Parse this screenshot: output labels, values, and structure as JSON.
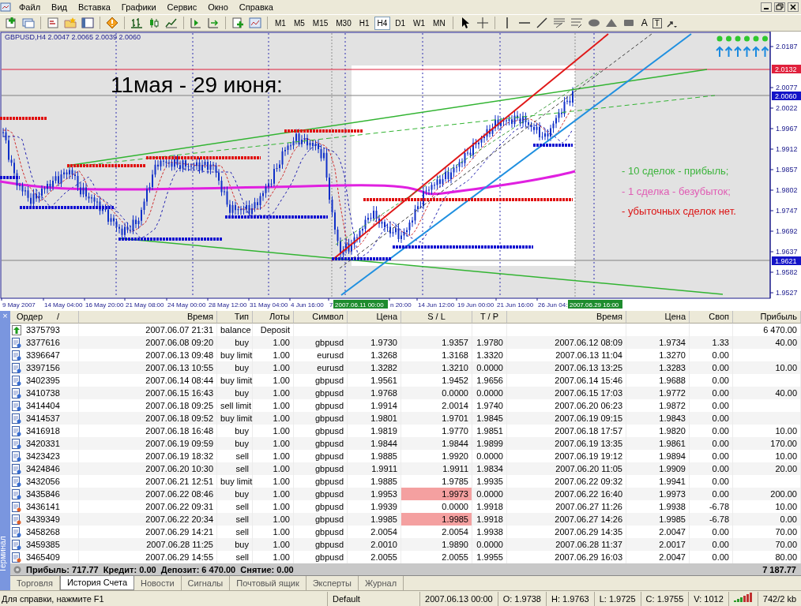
{
  "menu": [
    "Файл",
    "Вид",
    "Вставка",
    "Графики",
    "Сервис",
    "Окно",
    "Справка"
  ],
  "toolbar": {
    "timeframes": [
      {
        "label": "M1",
        "selected": false
      },
      {
        "label": "M5",
        "selected": false
      },
      {
        "label": "M15",
        "selected": false
      },
      {
        "label": "M30",
        "selected": false
      },
      {
        "label": "H1",
        "selected": false
      },
      {
        "label": "H4",
        "selected": true
      },
      {
        "label": "D1",
        "selected": false
      },
      {
        "label": "W1",
        "selected": false
      },
      {
        "label": "MN",
        "selected": false
      }
    ],
    "tool_letters": [
      "A",
      "T"
    ]
  },
  "chart": {
    "header": "GBPUSD,H4  2.0047 2.0065 2.0039 2.0060",
    "headline": "11мая - 29 июня:",
    "notes": [
      {
        "text": "- 10 сделок - прибыль;",
        "color": "#3cb43c"
      },
      {
        "text": "- 1 сделка - безубыток;",
        "color": "#e05cb4"
      },
      {
        "text": "- убыточных сделок нет.",
        "color": "#dc1414"
      }
    ],
    "price_axis": [
      {
        "label": "2.0187",
        "kind": "tick"
      },
      {
        "label": "2.0132",
        "kind": "marker",
        "color": "#e0203c"
      },
      {
        "label": "2.0077",
        "kind": "tick"
      },
      {
        "label": "2.0060",
        "kind": "marker",
        "color": "#1414c8"
      },
      {
        "label": "2.0022",
        "kind": "tick"
      },
      {
        "label": "1.9967",
        "kind": "tick"
      },
      {
        "label": "1.9912",
        "kind": "tick"
      },
      {
        "label": "1.9857",
        "kind": "tick"
      },
      {
        "label": "1.9802",
        "kind": "tick"
      },
      {
        "label": "1.9747",
        "kind": "tick"
      },
      {
        "label": "1.9692",
        "kind": "tick"
      },
      {
        "label": "1.9637",
        "kind": "tick"
      },
      {
        "label": "1.9621",
        "kind": "marker",
        "color": "#1414c8"
      },
      {
        "label": "1.9582",
        "kind": "tick"
      },
      {
        "label": "1.9527",
        "kind": "tick"
      }
    ],
    "time_axis": [
      {
        "label": "9 May 2007",
        "kind": "tick"
      },
      {
        "label": "14 May 04:00",
        "kind": "tick"
      },
      {
        "label": "16 May 20:00",
        "kind": "tick"
      },
      {
        "label": "21 May 08:00",
        "kind": "tick"
      },
      {
        "label": "24 May 00:00",
        "kind": "tick"
      },
      {
        "label": "28 May 12:00",
        "kind": "tick"
      },
      {
        "label": "31 May 04:00",
        "kind": "tick"
      },
      {
        "label": "4 Jun 16:00",
        "kind": "tick"
      },
      {
        "label": "7",
        "kind": "tick"
      },
      {
        "label": "2007.06.11 00:00",
        "kind": "marker"
      },
      {
        "label": "n 20:00",
        "kind": "tick"
      },
      {
        "label": "14 Jun 12:00",
        "kind": "tick"
      },
      {
        "label": "19 Jun 00:00",
        "kind": "tick"
      },
      {
        "label": "21 Jun 16:00",
        "kind": "tick"
      },
      {
        "label": "26 Jun 04:",
        "kind": "tick"
      },
      {
        "label": "2007.06.29 16:00",
        "kind": "marker"
      }
    ]
  },
  "terminal": {
    "title": "Терминал",
    "close": "×",
    "sort_mark": "/",
    "columns": [
      "Ордер",
      "Время",
      "Тип",
      "Лоты",
      "Символ",
      "Цена",
      "S / L",
      "T / P",
      "Время",
      "Цена",
      "Своп",
      "Прибыль"
    ],
    "rows": [
      {
        "kind": "balance",
        "sl_highlight": false,
        "order": "3375793",
        "open_time": "2007.06.07 21:31",
        "type": "balance",
        "size": "Deposit",
        "profit": "6 470.00"
      },
      {
        "kind": "buy",
        "sl_highlight": false,
        "order": "3377616",
        "open_time": "2007.06.08 09:20",
        "type": "buy",
        "size": "1.00",
        "symbol": "gbpusd",
        "open_price": "1.9730",
        "sl": "1.9357",
        "tp": "1.9780",
        "close_time": "2007.06.12 08:09",
        "close_price": "1.9734",
        "swap": "1.33",
        "profit": "40.00"
      },
      {
        "kind": "buy",
        "sl_highlight": false,
        "order": "3396647",
        "open_time": "2007.06.13 09:48",
        "type": "buy limit",
        "size": "1.00",
        "symbol": "eurusd",
        "open_price": "1.3268",
        "sl": "1.3168",
        "tp": "1.3320",
        "close_time": "2007.06.13 11:04",
        "close_price": "1.3270",
        "swap": "0.00"
      },
      {
        "kind": "buy",
        "sl_highlight": false,
        "order": "3397156",
        "open_time": "2007.06.13 10:55",
        "type": "buy",
        "size": "1.00",
        "symbol": "eurusd",
        "open_price": "1.3282",
        "sl": "1.3210",
        "tp": "0.0000",
        "close_time": "2007.06.13 13:25",
        "close_price": "1.3283",
        "swap": "0.00",
        "profit": "10.00"
      },
      {
        "kind": "buy",
        "sl_highlight": false,
        "order": "3402395",
        "open_time": "2007.06.14 08:44",
        "type": "buy limit",
        "size": "1.00",
        "symbol": "gbpusd",
        "open_price": "1.9561",
        "sl": "1.9452",
        "tp": "1.9656",
        "close_time": "2007.06.14 15:46",
        "close_price": "1.9688",
        "swap": "0.00"
      },
      {
        "kind": "buy",
        "sl_highlight": false,
        "order": "3410738",
        "open_time": "2007.06.15 16:43",
        "type": "buy",
        "size": "1.00",
        "symbol": "gbpusd",
        "open_price": "1.9768",
        "sl": "0.0000",
        "tp": "0.0000",
        "close_time": "2007.06.15 17:03",
        "close_price": "1.9772",
        "swap": "0.00",
        "profit": "40.00"
      },
      {
        "kind": "buy",
        "sl_highlight": false,
        "order": "3414404",
        "open_time": "2007.06.18 09:25",
        "type": "sell limit",
        "size": "1.00",
        "symbol": "gbpusd",
        "open_price": "1.9914",
        "sl": "2.0014",
        "tp": "1.9740",
        "close_time": "2007.06.20 06:23",
        "close_price": "1.9872",
        "swap": "0.00"
      },
      {
        "kind": "buy",
        "sl_highlight": false,
        "order": "3414537",
        "open_time": "2007.06.18 09:52",
        "type": "buy limit",
        "size": "1.00",
        "symbol": "gbpusd",
        "open_price": "1.9801",
        "sl": "1.9701",
        "tp": "1.9845",
        "close_time": "2007.06.19 09:15",
        "close_price": "1.9843",
        "swap": "0.00"
      },
      {
        "kind": "buy",
        "sl_highlight": false,
        "order": "3416918",
        "open_time": "2007.06.18 16:48",
        "type": "buy",
        "size": "1.00",
        "symbol": "gbpusd",
        "open_price": "1.9819",
        "sl": "1.9770",
        "tp": "1.9851",
        "close_time": "2007.06.18 17:57",
        "close_price": "1.9820",
        "swap": "0.00",
        "profit": "10.00"
      },
      {
        "kind": "buy",
        "sl_highlight": false,
        "order": "3420331",
        "open_time": "2007.06.19 09:59",
        "type": "buy",
        "size": "1.00",
        "symbol": "gbpusd",
        "open_price": "1.9844",
        "sl": "1.9844",
        "tp": "1.9899",
        "close_time": "2007.06.19 13:35",
        "close_price": "1.9861",
        "swap": "0.00",
        "profit": "170.00"
      },
      {
        "kind": "buy",
        "sl_highlight": false,
        "order": "3423423",
        "open_time": "2007.06.19 18:32",
        "type": "sell",
        "size": "1.00",
        "symbol": "gbpusd",
        "open_price": "1.9885",
        "sl": "1.9920",
        "tp": "0.0000",
        "close_time": "2007.06.19 19:12",
        "close_price": "1.9894",
        "swap": "0.00",
        "profit": "10.00"
      },
      {
        "kind": "buy",
        "sl_highlight": false,
        "order": "3424846",
        "open_time": "2007.06.20 10:30",
        "type": "sell",
        "size": "1.00",
        "symbol": "gbpusd",
        "open_price": "1.9911",
        "sl": "1.9911",
        "tp": "1.9834",
        "close_time": "2007.06.20 11:05",
        "close_price": "1.9909",
        "swap": "0.00",
        "profit": "20.00"
      },
      {
        "kind": "buy",
        "sl_highlight": false,
        "order": "3432056",
        "open_time": "2007.06.21 12:51",
        "type": "buy limit",
        "size": "1.00",
        "symbol": "gbpusd",
        "open_price": "1.9885",
        "sl": "1.9785",
        "tp": "1.9935",
        "close_time": "2007.06.22 09:32",
        "close_price": "1.9941",
        "swap": "0.00"
      },
      {
        "kind": "buy",
        "sl_highlight": true,
        "order": "3435846",
        "open_time": "2007.06.22 08:46",
        "type": "buy",
        "size": "1.00",
        "symbol": "gbpusd",
        "open_price": "1.9953",
        "sl": "1.9973",
        "tp": "0.0000",
        "close_time": "2007.06.22 16:40",
        "close_price": "1.9973",
        "swap": "0.00",
        "profit": "200.00"
      },
      {
        "kind": "sell",
        "sl_highlight": false,
        "order": "3436141",
        "open_time": "2007.06.22 09:31",
        "type": "sell",
        "size": "1.00",
        "symbol": "gbpusd",
        "open_price": "1.9939",
        "sl": "0.0000",
        "tp": "1.9918",
        "close_time": "2007.06.27 11:26",
        "close_price": "1.9938",
        "swap": "-6.78",
        "profit": "10.00"
      },
      {
        "kind": "sell",
        "sl_highlight": true,
        "order": "3439349",
        "open_time": "2007.06.22 20:34",
        "type": "sell",
        "size": "1.00",
        "symbol": "gbpusd",
        "open_price": "1.9985",
        "sl": "1.9985",
        "tp": "1.9918",
        "close_time": "2007.06.27 14:26",
        "close_price": "1.9985",
        "swap": "-6.78",
        "profit": "0.00"
      },
      {
        "kind": "buy",
        "sl_highlight": false,
        "order": "3458268",
        "open_time": "2007.06.29 14:21",
        "type": "sell",
        "size": "1.00",
        "symbol": "gbpusd",
        "open_price": "2.0054",
        "sl": "2.0054",
        "tp": "1.9938",
        "close_time": "2007.06.29 14:35",
        "close_price": "2.0047",
        "swap": "0.00",
        "profit": "70.00"
      },
      {
        "kind": "buy",
        "sl_highlight": false,
        "order": "3459385",
        "open_time": "2007.06.28 11:25",
        "type": "buy",
        "size": "1.00",
        "symbol": "gbpusd",
        "open_price": "2.0010",
        "sl": "1.9890",
        "tp": "0.0000",
        "close_time": "2007.06.28 11:37",
        "close_price": "2.0017",
        "swap": "0.00",
        "profit": "70.00"
      },
      {
        "kind": "sell",
        "sl_highlight": false,
        "order": "3465409",
        "open_time": "2007.06.29 14:55",
        "type": "sell",
        "size": "1.00",
        "symbol": "gbpusd",
        "open_price": "2.0055",
        "sl": "2.0055",
        "tp": "1.9955",
        "close_time": "2007.06.29 16:03",
        "close_price": "2.0047",
        "swap": "0.00",
        "profit": "80.00"
      }
    ],
    "summary": {
      "text": "Прибыль: 717.77  Кредит: 0.00  Депозит: 6 470.00  Снятие: 0.00",
      "total": "7 187.77"
    },
    "tabs": [
      {
        "label": "Торговля",
        "selected": false
      },
      {
        "label": "История Счета",
        "selected": true
      },
      {
        "label": "Новости",
        "selected": false
      },
      {
        "label": "Сигналы",
        "selected": false
      },
      {
        "label": "Почтовый ящик",
        "selected": false
      },
      {
        "label": "Эксперты",
        "selected": false
      },
      {
        "label": "Журнал",
        "selected": false
      }
    ]
  },
  "status_bar": {
    "help": "Для справки, нажмите F1",
    "profile": "Default",
    "fields": [
      "2007.06.13 00:00",
      "O: 1.9738",
      "H: 1.9763",
      "L: 1.9725",
      "C: 1.9755",
      "V: 1012"
    ],
    "traffic": "742/2 kb"
  }
}
